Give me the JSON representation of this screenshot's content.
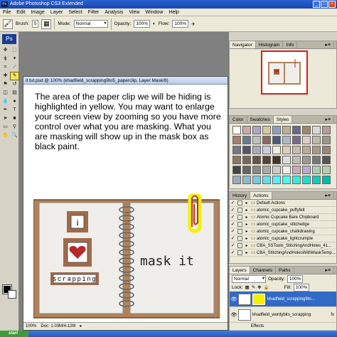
{
  "app": {
    "title": "Adobe Photoshop CS3 Extended",
    "logo": "Ps"
  },
  "menu": [
    "File",
    "Edit",
    "Image",
    "Layer",
    "Select",
    "Filter",
    "Analysis",
    "View",
    "Window",
    "Help"
  ],
  "options": {
    "brush_label": "Brush:",
    "brush_size": "5",
    "mode_label": "Mode:",
    "mode_value": "Normal",
    "opacity_label": "Opacity:",
    "opacity_value": "100%",
    "flow_label": "Flow:",
    "flow_value": "100%"
  },
  "document": {
    "title": "it tut.psd @ 100% (khadfield_scrapping9to5_paperclip, Layer Mask/8)",
    "instructions": "The area of the paper clip we will be hiding is highlighted in yellow. You may want to enlarge your screen view by zooming so you have more control over what you are masking. What you are masking will show up in the mask box as black paint.",
    "zoom": "100%",
    "doc_size": "Doc: 1.03M/4.12M",
    "notebook": {
      "letter": "i",
      "word": "scrapping",
      "handwriting": "mask it"
    }
  },
  "navigator": {
    "tabs": [
      "Navigator",
      "Histogram",
      "Info"
    ]
  },
  "styles": {
    "tabs": [
      "Color",
      "Swatches",
      "Styles"
    ],
    "swatch_colors": [
      "#ffffff",
      "#c9a9a9",
      "#b0a4c8",
      "#d8c8a0",
      "#8aa0c0",
      "#c0b090",
      "#6a6a8a",
      "#9a8a6a",
      "#d9d9d9",
      "#b89aa0",
      "#a08070",
      "#6a7a8a",
      "#c0c0c0",
      "#8a6a5a",
      "#4a5a7a",
      "#a9b9c9",
      "#7a6a8a",
      "#dcc",
      "#bba",
      "#998",
      "#778",
      "#556",
      "#aab",
      "#ccd",
      "#eed",
      "#dcb",
      "#cba",
      "#ba9",
      "#a98",
      "#987",
      "#876",
      "#765",
      "#654",
      "#543",
      "#432",
      "#ddd",
      "#bbb",
      "#999",
      "#777",
      "#555",
      "#444",
      "#666",
      "#888",
      "#aaa",
      "#ccc",
      "#eee",
      "#cab",
      "#bac",
      "#acb",
      "#bca",
      "#9ab",
      "#8bc",
      "#7cd",
      "#6de",
      "#5ef",
      "#4fe",
      "#3ed",
      "#2dc",
      "#1cb",
      "#0ba"
    ]
  },
  "actions": {
    "tabs": [
      "History",
      "Actions"
    ],
    "items": [
      {
        "label": "Default Actions",
        "checked": true
      },
      {
        "label": "atomic_cupcake_puffyfelt",
        "checked": true
      },
      {
        "label": "Atomic Cupcake Bare Chipboard",
        "checked": true
      },
      {
        "label": "atomic_cupcake_stitchedge",
        "checked": true
      },
      {
        "label": "atomic_cupcake_chalkdrawing",
        "checked": true
      },
      {
        "label": "atomic_cupcake_lightcrumple",
        "checked": true
      },
      {
        "label": "CBA_SSTools_StitchingAndHoles_41...",
        "checked": true
      },
      {
        "label": "CBA_StitchingAndHolesWithMaskTemp...",
        "checked": true
      }
    ]
  },
  "layers": {
    "tabs": [
      "Layers",
      "Channels",
      "Paths"
    ],
    "blend_mode": "Normal",
    "opacity_label": "Opacity:",
    "opacity_value": "100%",
    "lock_label": "Lock:",
    "fill_label": "Fill:",
    "fill_value": "100%",
    "items": [
      {
        "name": "khadfield_scrapping9to...",
        "selected": true
      },
      {
        "name": "khadfield_wordybits_scrapping",
        "selected": false
      },
      {
        "name": "Effects",
        "selected": false
      }
    ]
  },
  "taskbar": {
    "start_label": "start"
  }
}
